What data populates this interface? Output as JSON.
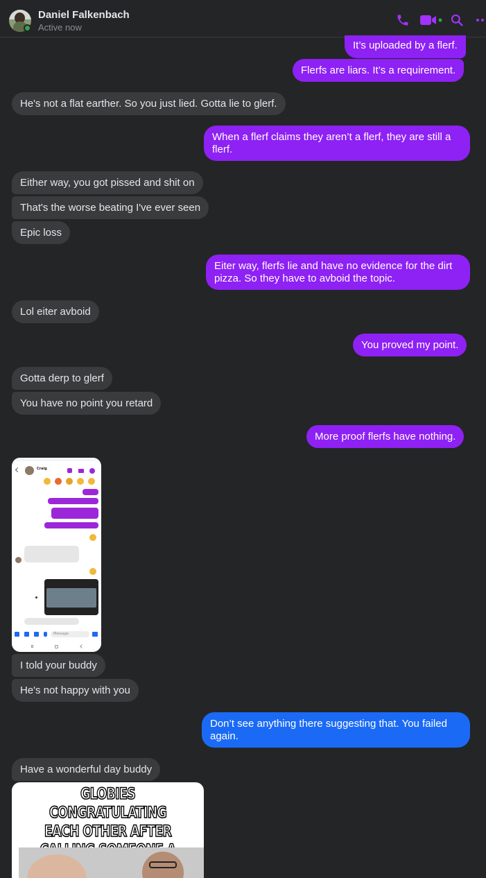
{
  "header": {
    "contact_name": "Daniel Falkenbach",
    "status": "Active now",
    "actions": [
      {
        "name": "phone-call-button",
        "icon": "phone-icon"
      },
      {
        "name": "video-call-button",
        "icon": "video-camera-icon"
      },
      {
        "name": "search-in-conversation-button",
        "icon": "search-icon"
      },
      {
        "name": "more-options-button",
        "icon": "more-horizontal-icon"
      }
    ]
  },
  "colors": {
    "background": "#242526",
    "outgoing_bubble": "#8e21f3",
    "outgoing_bubble_last": "#1b6af5",
    "incoming_bubble": "#3a3b3c",
    "accent_icons": "#a033ff",
    "online": "#31a24c"
  },
  "messages": [
    {
      "direction": "out",
      "text": "It’s uploaded by a flerf."
    },
    {
      "direction": "out",
      "text": "Flerfs are liars.  It’s a requirement."
    },
    {
      "direction": "in",
      "text": "He's not a flat earther. So you just lied. Gotta lie to glerf."
    },
    {
      "direction": "out",
      "text": "When a flerf claims they aren’t a flerf, they are still a flerf."
    },
    {
      "direction": "in",
      "text": "Either way, you got pissed and shit on"
    },
    {
      "direction": "in",
      "text": "That's the worse beating I've ever seen"
    },
    {
      "direction": "in",
      "text": "Epic loss"
    },
    {
      "direction": "out",
      "text": "Eiter way, flerfs lie and have no evidence for the dirt pizza.  So they have to avboid the topic."
    },
    {
      "direction": "in",
      "text": "Lol eiter avboid"
    },
    {
      "direction": "out",
      "text": "You proved my point."
    },
    {
      "direction": "in",
      "text": "Gotta derp to glerf"
    },
    {
      "direction": "in",
      "text": "You have no point you retard"
    },
    {
      "direction": "out",
      "text": "More proof flerfs have nothing."
    },
    {
      "direction": "in",
      "type": "image",
      "image": "screenshot-attachment"
    },
    {
      "direction": "in",
      "text": "I told your buddy"
    },
    {
      "direction": "in",
      "text": "He's not happy with you"
    },
    {
      "direction": "out",
      "text": "Don’t see anything there suggesting that.  You failed again."
    },
    {
      "direction": "in",
      "text": "Have a wonderful day buddy"
    },
    {
      "direction": "in",
      "type": "image",
      "image": "meme-attachment",
      "caption_lines": [
        "GLOBIES CONGRATULATING",
        "EACH OTHER AFTER",
        "CALLING SOMEONE A FLERF..."
      ]
    }
  ],
  "attachment_screenshot": {
    "contact": "Craig",
    "out_bubbles": [
      "Poor sport",
      "Also, what an embarrassment",
      "Je have nothing. proves nothing but his ignorance",
      "Highlight of his lifestyle"
    ],
    "in_bubbles": [
      "Ok ill tell the guy that they never happened. I bet never happened in the moon."
    ],
    "image_caption": "AT ALL THE THINGS THAT NEVER HAPPENED",
    "in_last": "Keep going buddy, carry them",
    "composer_placeholder": "Message"
  }
}
